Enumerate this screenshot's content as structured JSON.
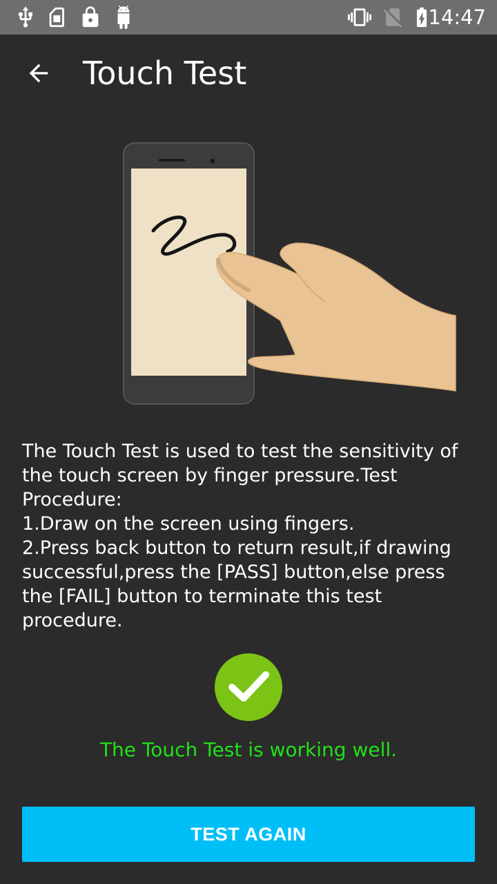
{
  "status_bar": {
    "left_icons": [
      "usb-icon",
      "sim-toolkit-icon",
      "lock-icon",
      "android-debug-icon"
    ],
    "right_icons": [
      "vibrate-icon",
      "no-sim-icon",
      "battery-charging-icon"
    ],
    "time": "14:47"
  },
  "app_bar": {
    "back_icon": "arrow-back-icon",
    "title": "Touch Test"
  },
  "illustration": {
    "icon": "phone-finger-drawing-illustration"
  },
  "description": {
    "lines": [
      "The Touch Test is used to test the sensitivity of the touch screen by finger pressure.Test Procedure:",
      "1.Draw on the screen using fingers.",
      "2.Press back button to return result,if drawing successful,press the [PASS] button,else press the [FAIL] button to terminate this test procedure."
    ]
  },
  "result": {
    "icon": "check-circle-icon",
    "text": "The Touch Test is working well.",
    "color": "#22e01a"
  },
  "actions": {
    "test_again_label": "TEST AGAIN",
    "button_color": "#00bff7"
  },
  "colors": {
    "background": "#2b2b2b",
    "status_bar": "#6e6e6e",
    "check_green": "#7bc314"
  }
}
